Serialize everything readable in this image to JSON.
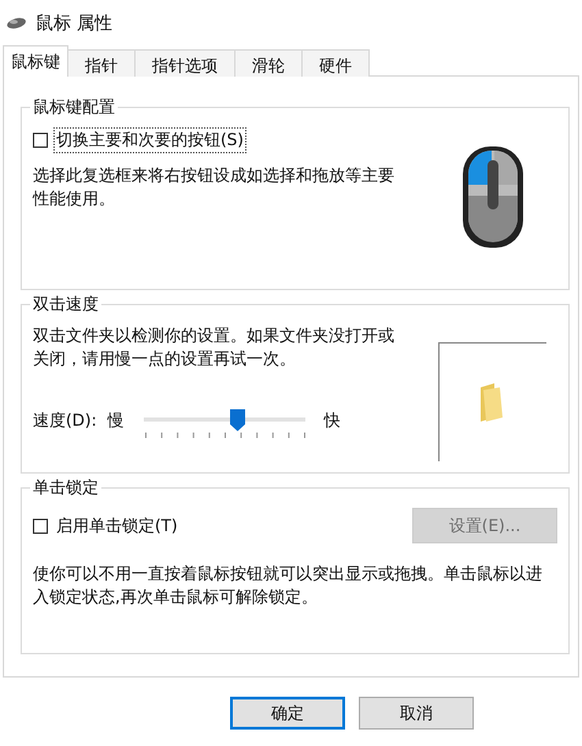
{
  "window": {
    "title": "鼠标 属性"
  },
  "tabs": [
    {
      "label": "鼠标键",
      "selected": true
    },
    {
      "label": "指针",
      "selected": false
    },
    {
      "label": "指针选项",
      "selected": false
    },
    {
      "label": "滑轮",
      "selected": false
    },
    {
      "label": "硬件",
      "selected": false
    }
  ],
  "button_config": {
    "title": "鼠标键配置",
    "checkbox": {
      "label": "切换主要和次要的按钮(S)",
      "checked": false
    },
    "description": "选择此复选框来将右按钮设成如选择和拖放等主要性能使用。"
  },
  "double_click": {
    "title": "双击速度",
    "description": "双击文件夹以检测你的设置。如果文件夹没打开或关闭，请用慢一点的设置再试一次。",
    "speed_label": "速度(D):",
    "slow_label": "慢",
    "fast_label": "快",
    "level": 0.58
  },
  "click_lock": {
    "title": "单击锁定",
    "checkbox": {
      "label": "启用单击锁定(T)",
      "checked": false
    },
    "settings_button": {
      "label": "设置(E)...",
      "disabled": true
    },
    "description": "使你可以不用一直按着鼠标按钮就可以突出显示或拖拽。单击鼠标以进入锁定状态,再次单击鼠标可解除锁定。"
  },
  "buttons": [
    {
      "label": "确定",
      "selected": true
    },
    {
      "label": "取消",
      "selected": false
    }
  ]
}
